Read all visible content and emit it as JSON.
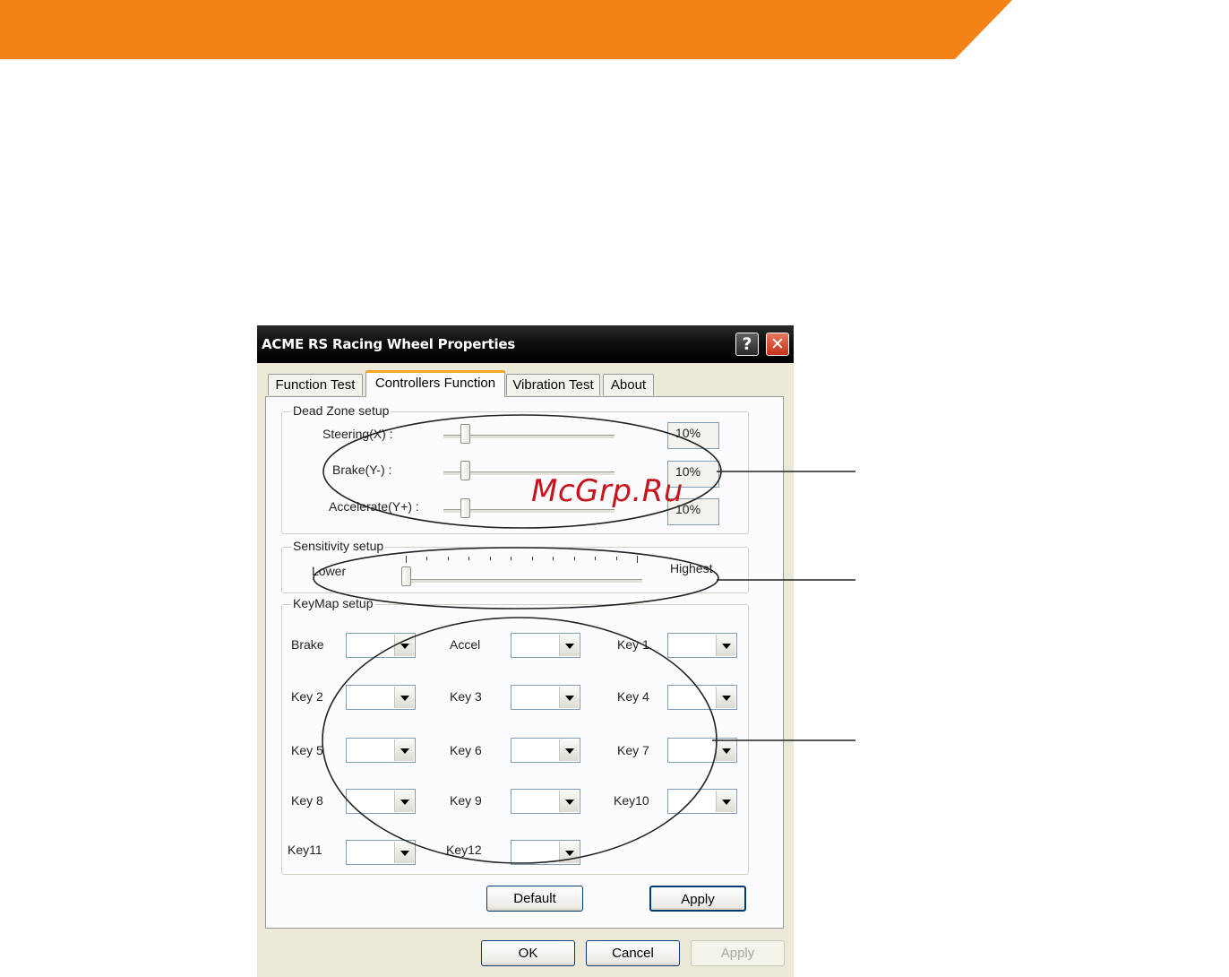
{
  "header": {
    "band_color": "#f58216"
  },
  "dialog": {
    "title": "ACME RS Racing Wheel Properties",
    "help_glyph": "?",
    "close_glyph": "✕",
    "tabs": [
      {
        "label": "Function Test",
        "active": false
      },
      {
        "label": "Controllers Function",
        "active": true
      },
      {
        "label": "Vibration Test",
        "active": false
      },
      {
        "label": "About",
        "active": false
      }
    ],
    "dead_zone": {
      "title": "Dead Zone setup",
      "rows": [
        {
          "label": "Steering(X) :",
          "value": "10%",
          "level_percent": 10
        },
        {
          "label": "Brake(Y-) :",
          "value": "10%",
          "level_percent": 10
        },
        {
          "label": "Accelerate(Y+) :",
          "value": "10%",
          "level_percent": 10
        }
      ]
    },
    "sensitivity": {
      "title": "Sensitivity setup",
      "low_label": "Lower",
      "high_label": "Highest",
      "level_percent": 0
    },
    "keymap": {
      "title": "KeyMap setup",
      "rows": [
        [
          "Brake",
          "Accel",
          "Key 1"
        ],
        [
          "Key 2",
          "Key 3",
          "Key 4"
        ],
        [
          "Key 5",
          "Key 6",
          "Key 7"
        ],
        [
          "Key 8",
          "Key 9",
          "Key10"
        ],
        [
          "Key11",
          "Key12"
        ]
      ]
    },
    "panel_buttons": {
      "default_label": "Default",
      "apply_label": "Apply"
    },
    "footer_buttons": {
      "ok_label": "OK",
      "cancel_label": "Cancel",
      "apply_label": "Apply"
    }
  },
  "watermark": {
    "text": "McGrp.Ru",
    "color": "#c4161c"
  }
}
